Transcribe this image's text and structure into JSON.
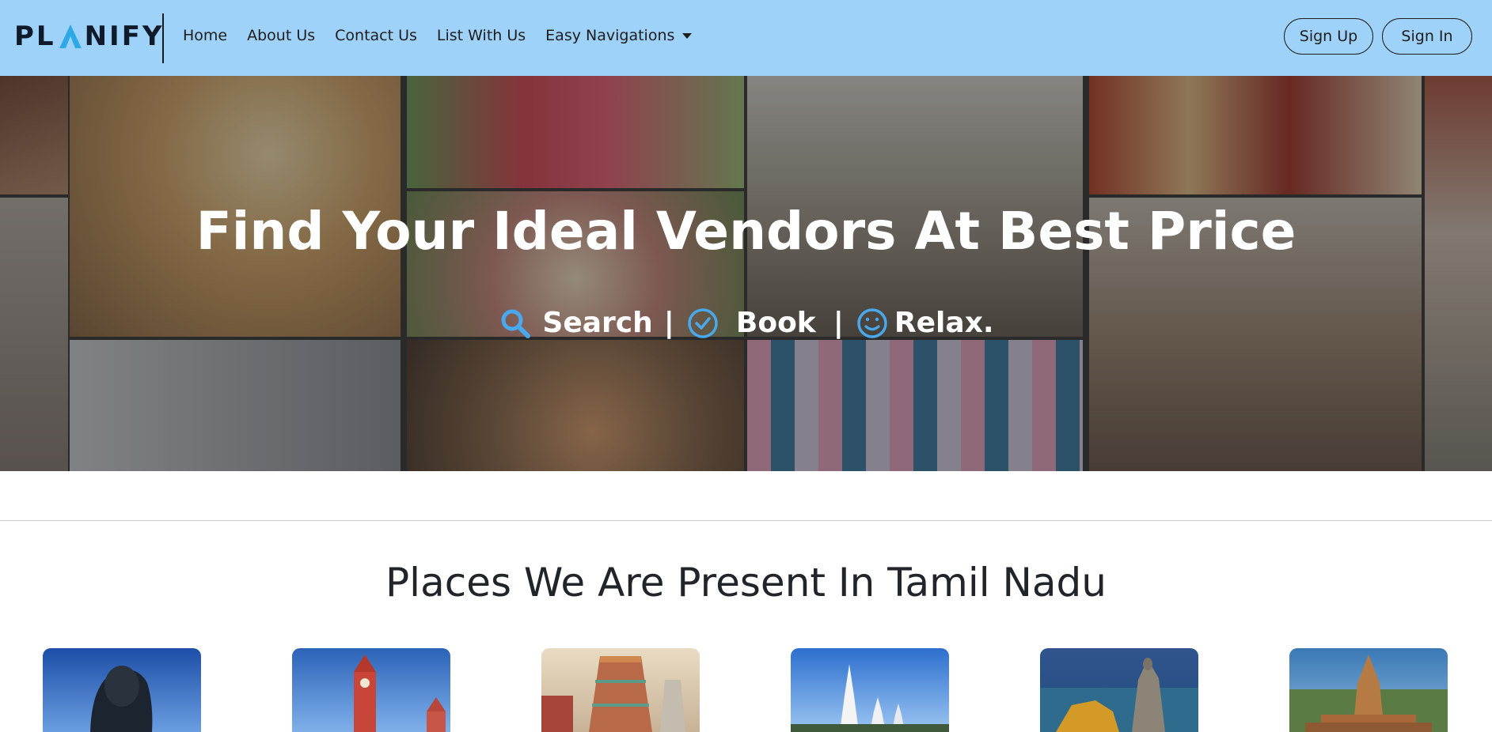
{
  "brand": {
    "logo_text_left": "PL",
    "logo_text_right": "NIFY",
    "accent": "#2fa8e8"
  },
  "nav": {
    "links": [
      "Home",
      "About Us",
      "Contact Us",
      "List With Us"
    ],
    "dropdown_label": "Easy Navigations",
    "signup_label": "Sign Up",
    "signin_label": "Sign In",
    "background": "#9fd2f9"
  },
  "hero": {
    "title": "Find Your Ideal Vendors At Best Price",
    "steps": [
      "Search",
      "Book",
      "Relax."
    ],
    "separator": "|",
    "icons": [
      "search-icon",
      "check-circle-icon",
      "smile-icon"
    ],
    "icon_color": "#4aa8ec"
  },
  "places": {
    "title": "Places We Are Present In Tamil Nadu",
    "cards": [
      "adiyogi-statue",
      "clock-tower",
      "temple-gopuram",
      "church",
      "coastal-memorial",
      "big-temple"
    ]
  }
}
